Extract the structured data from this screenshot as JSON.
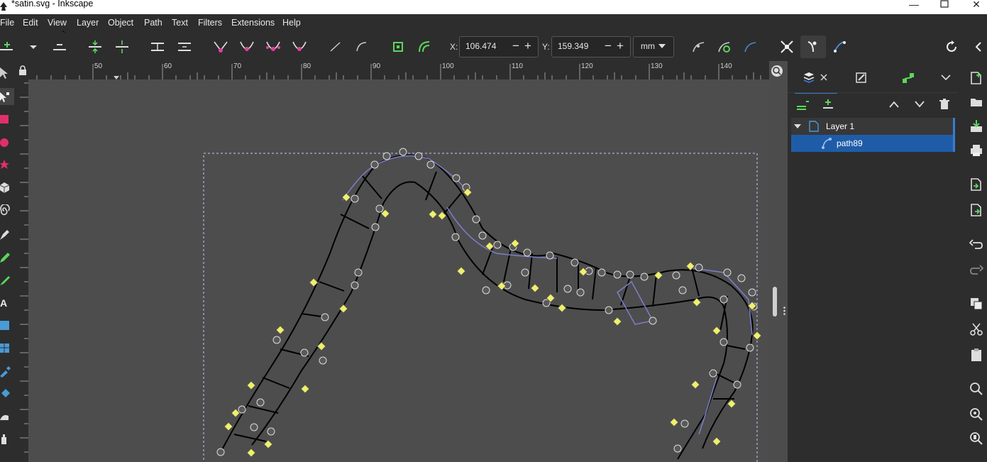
{
  "window": {
    "title": "*satin.svg - Inkscape"
  },
  "menubar": {
    "items": [
      "File",
      "Edit",
      "View",
      "Layer",
      "Object",
      "Path",
      "Text",
      "Filters",
      "Extensions",
      "Help"
    ]
  },
  "toolbar": {
    "x_label": "X:",
    "x_value": "106.474",
    "y_label": "Y:",
    "y_value": "159.349",
    "unit": "mm"
  },
  "ruler": {
    "labels": [
      "50",
      "60",
      "70",
      "80",
      "90",
      "100",
      "110",
      "120",
      "130",
      "140"
    ]
  },
  "layers": {
    "rows": [
      {
        "label": "Layer 1"
      },
      {
        "label": "path89"
      }
    ]
  },
  "colors": {
    "ui_dark": "#2d2d2d",
    "canvas": "#4d4d4d",
    "selection": "#1f5ca8",
    "accent": "#3a7bd5",
    "node_yellow": "#f0f06a"
  }
}
